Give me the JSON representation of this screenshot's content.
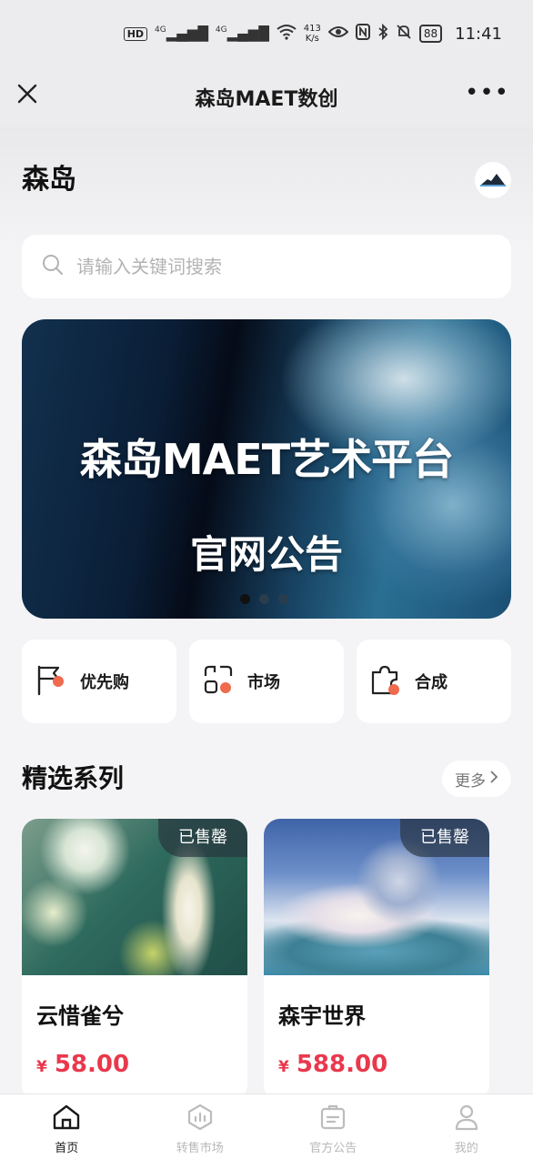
{
  "status_bar": {
    "hd_label": "HD",
    "signal_label": "4G",
    "speed": "413",
    "speed_unit": "K/s",
    "battery": "88",
    "time": "11:41"
  },
  "navbar": {
    "title": "森岛MAET数创",
    "close_icon": "close-icon",
    "more_icon": "more-icon"
  },
  "header": {
    "title": "森岛"
  },
  "search": {
    "placeholder": "请输入关键词搜索",
    "value": ""
  },
  "banner": {
    "title": "森岛MAET艺术平台",
    "subtitle": "官网公告",
    "slide_count": 3,
    "active_index": 0
  },
  "quick_actions": [
    {
      "label": "优先购",
      "icon": "flag-icon"
    },
    {
      "label": "市场",
      "icon": "market-icon"
    },
    {
      "label": "合成",
      "icon": "puzzle-icon"
    }
  ],
  "section": {
    "title": "精选系列",
    "more_label": "更多"
  },
  "collections": [
    {
      "name": "云惜雀兮",
      "price": "58.00",
      "currency": "¥",
      "badge": "已售罄"
    },
    {
      "name": "森宇世界",
      "price": "588.00",
      "currency": "¥",
      "badge": "已售罄"
    }
  ],
  "tabbar": [
    {
      "label": "首页",
      "icon": "home-icon",
      "active": true
    },
    {
      "label": "转售市场",
      "icon": "resale-icon",
      "active": false
    },
    {
      "label": "官方公告",
      "icon": "announcement-icon",
      "active": false
    },
    {
      "label": "我的",
      "icon": "profile-icon",
      "active": false
    }
  ],
  "colors": {
    "accent": "#e9384c",
    "icon_accent": "#f06a4d"
  }
}
